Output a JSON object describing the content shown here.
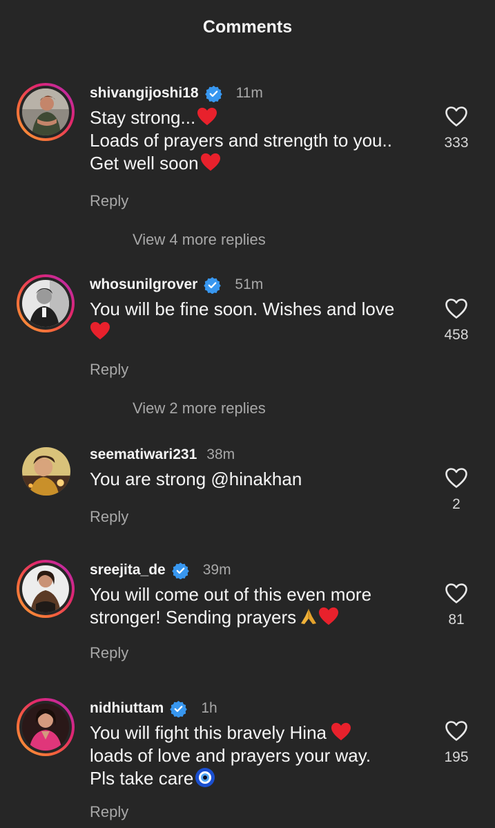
{
  "header": {
    "title": "Comments"
  },
  "colors": {
    "background": "#262626",
    "verified": "#3897f0",
    "secondary_text": "#a8a8a8",
    "heart_emoji": "#e8212c"
  },
  "comments": [
    {
      "username": "shivangijoshi18",
      "verified": true,
      "time": "11m",
      "lines": [
        "Stay strong...",
        "Loads of prayers and strength to you..",
        "Get well soon"
      ],
      "likes": "333",
      "reply_label": "Reply",
      "view_replies": "View 4 more replies"
    },
    {
      "username": "whosunilgrover",
      "verified": true,
      "time": "51m",
      "lines": [
        "You will be fine soon. Wishes and love"
      ],
      "likes": "458",
      "reply_label": "Reply",
      "view_replies": "View 2 more replies"
    },
    {
      "username": "seematiwari231",
      "verified": false,
      "time": "38m",
      "lines": [
        "You are strong @hinakhan"
      ],
      "likes": "2",
      "reply_label": "Reply"
    },
    {
      "username": "sreejita_de",
      "verified": true,
      "time": "39m",
      "lines": [
        "You will come out of this even more",
        "stronger! Sending prayers"
      ],
      "likes": "81",
      "reply_label": "Reply"
    },
    {
      "username": "nidhiuttam",
      "verified": true,
      "time": "1h",
      "lines": [
        "You will fight this bravely Hina",
        "loads of love and prayers your way.",
        "Pls take care"
      ],
      "likes": "195",
      "reply_label": "Reply"
    }
  ],
  "icons": {
    "like": "heart-outline-icon",
    "verified": "verified-badge-icon"
  }
}
